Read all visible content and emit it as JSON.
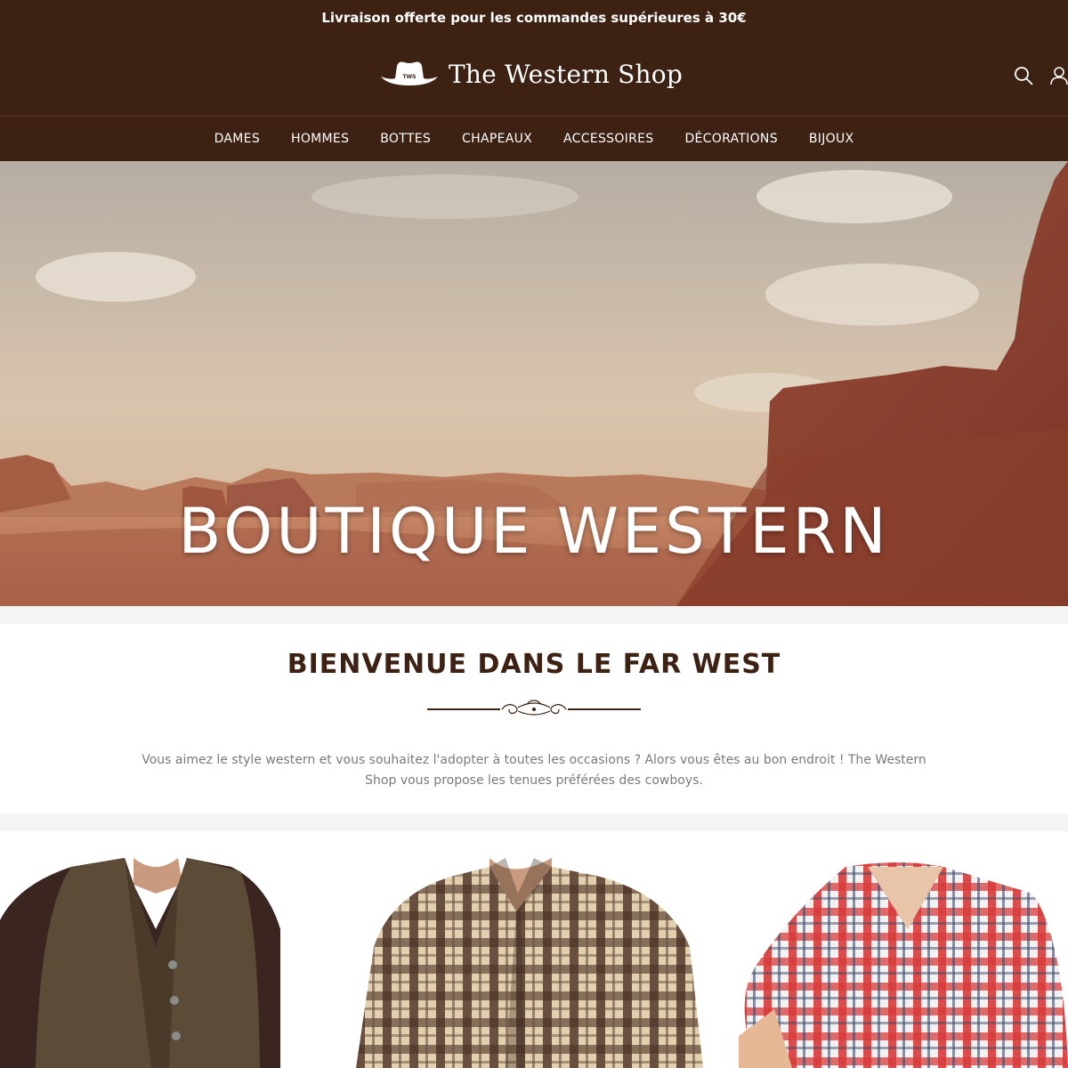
{
  "announcement": "Livraison offerte pour les commandes supérieures à 30€",
  "brand": {
    "name": "The Western Shop",
    "logo_icon": "cowboy-hat-logo",
    "logo_badge": "TWS"
  },
  "header_icons": [
    "search-icon",
    "account-icon"
  ],
  "nav": {
    "items": [
      "DAMES",
      "HOMMES",
      "BOTTES",
      "CHAPEAUX",
      "ACCESSOIRES",
      "DÉCORATIONS",
      "BIJOUX"
    ]
  },
  "hero": {
    "title": "BOUTIQUE WESTERN"
  },
  "welcome": {
    "title": "BIENVENUE DANS LE FAR WEST",
    "text": "Vous aimez le style western et vous souhaitez l'adopter à toutes les occasions ? Alors vous êtes au bon endroit ! The Western Shop vous propose les tenues préférées des cowboys."
  },
  "products": [
    "brown-tweed-vest",
    "brown-plaid-shirt",
    "red-plaid-shirt"
  ],
  "colors": {
    "brand_brown": "#3d2213",
    "text_grey": "#7a7a7a",
    "background": "#f4f4f4"
  }
}
